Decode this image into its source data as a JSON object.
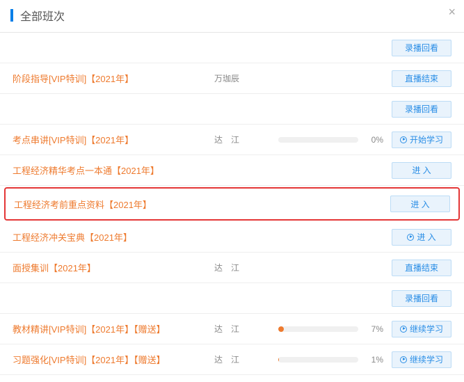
{
  "header": {
    "title": "全部班次",
    "close_icon": "×"
  },
  "buttons": {
    "replay": "录播回看",
    "live_ended": "直播结束",
    "start_study": "开始学习",
    "enter": "进 入",
    "continue_study": "继续学习"
  },
  "rows": [
    {
      "type": "action_only",
      "action": "replay"
    },
    {
      "type": "course",
      "title": "阶段指导[VIP特训]【2021年】",
      "teacher": "万珈辰",
      "action": "live_ended"
    },
    {
      "type": "action_only",
      "action": "replay"
    },
    {
      "type": "course_progress",
      "title": "考点串讲[VIP特训]【2021年】",
      "teacher": "达　江",
      "progress": 0,
      "progress_label": "0%",
      "action": "start_study",
      "action_play": true
    },
    {
      "type": "course",
      "title": "工程经济精华考点一本通【2021年】",
      "teacher": "",
      "action": "enter"
    },
    {
      "type": "highlight",
      "title": "工程经济考前重点资料【2021年】",
      "teacher": "",
      "action": "enter"
    },
    {
      "type": "course",
      "title": "工程经济冲关宝典【2021年】",
      "teacher": "",
      "action": "enter",
      "action_play": true
    },
    {
      "type": "course",
      "title": "面授集训【2021年】",
      "teacher": "达　江",
      "action": "live_ended"
    },
    {
      "type": "action_only",
      "action": "replay"
    },
    {
      "type": "course_progress",
      "title": "教材精讲[VIP特训]【2021年】【赠送】",
      "teacher": "达　江",
      "progress": 7,
      "progress_label": "7%",
      "action": "continue_study",
      "action_play": true
    },
    {
      "type": "course_progress",
      "title": "习题强化[VIP特训]【2021年】【赠送】",
      "teacher": "达　江",
      "progress": 1,
      "progress_label": "1%",
      "action": "continue_study",
      "action_play": true
    }
  ]
}
